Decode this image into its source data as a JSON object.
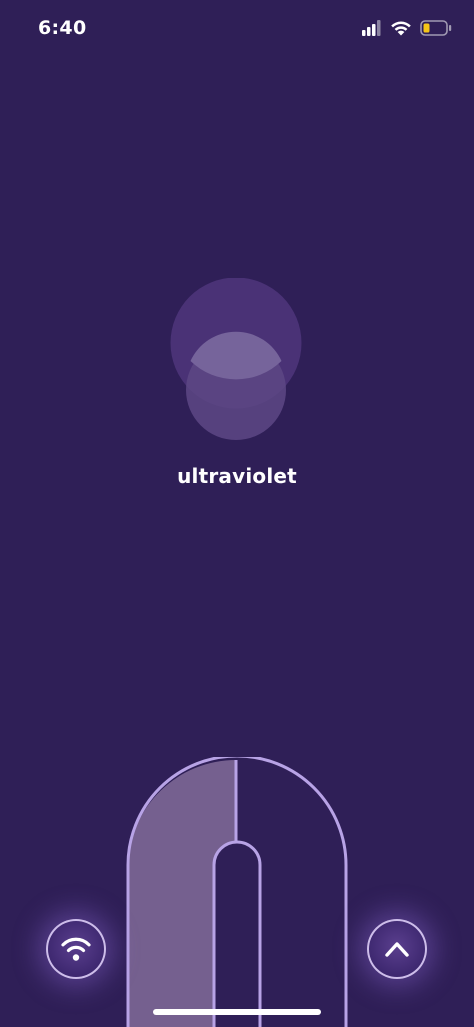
{
  "status_bar": {
    "time": "6:40",
    "icons": [
      "cellular-signal-icon",
      "wifi-icon",
      "battery-icon"
    ],
    "battery_color": "#f5c518"
  },
  "brand": {
    "name": "ultraviolet",
    "logo_icon": "overlapping-circles-logo"
  },
  "device": {
    "icon": "device-outline-icon",
    "fill_color": "#75608f",
    "stroke_color": "#b8a3e6"
  },
  "buttons": {
    "left_icon": "wifi-icon",
    "right_icon": "chevron-up-icon"
  },
  "colors": {
    "background": "#2f1f57",
    "accent": "#b8a3e6"
  }
}
